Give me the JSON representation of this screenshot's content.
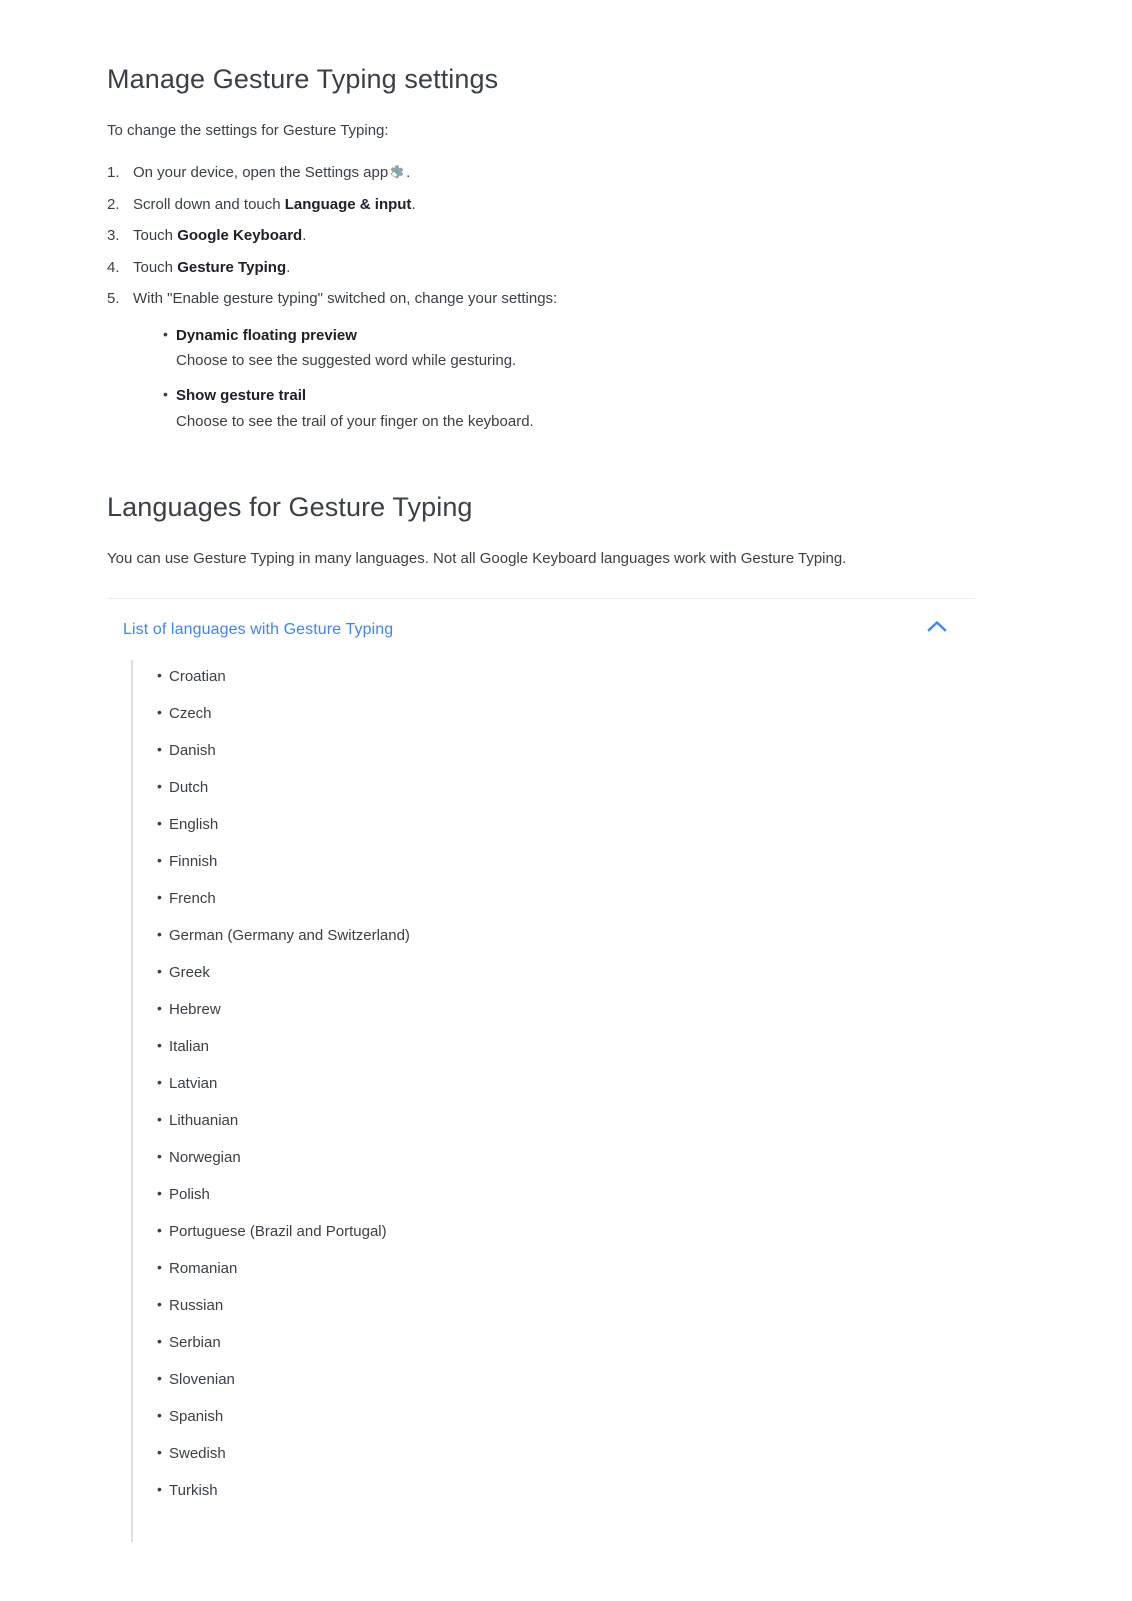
{
  "section1": {
    "heading": "Manage Gesture Typing settings",
    "intro": "To change the settings for Gesture Typing:",
    "steps": [
      {
        "pre": "On your device, open the Settings app",
        "icon": "gear-icon",
        "post": ".",
        "bold": "",
        "tail": ""
      },
      {
        "pre": "Scroll down and touch ",
        "bold": "Language & input",
        "post": "."
      },
      {
        "pre": "Touch ",
        "bold": "Google Keyboard",
        "post": "."
      },
      {
        "pre": "Touch ",
        "bold": "Gesture Typing",
        "post": "."
      },
      {
        "pre": "With \"Enable gesture typing\" switched on, change your settings:",
        "bold": "",
        "post": ""
      }
    ],
    "substeps": [
      {
        "title": "Dynamic floating preview",
        "desc": "Choose to see the suggested word while gesturing."
      },
      {
        "title": "Show gesture trail",
        "desc": "Choose to see the trail of your finger on the keyboard."
      }
    ]
  },
  "section2": {
    "heading": "Languages for Gesture Typing",
    "intro": "You can use Gesture Typing in many languages. Not all Google Keyboard languages work with Gesture Typing.",
    "expander": {
      "title": "List of languages with Gesture Typing",
      "state": "expanded",
      "icon": "chevron-up-icon",
      "languages": [
        "Croatian",
        "Czech",
        "Danish",
        "Dutch",
        "English",
        "Finnish",
        "French",
        "German (Germany and Switzerland)",
        "Greek",
        "Hebrew",
        "Italian",
        "Latvian",
        "Lithuanian",
        "Norwegian",
        "Polish",
        "Portuguese (Brazil and Portugal)",
        "Romanian",
        "Russian",
        "Serbian",
        "Slovenian",
        "Spanish",
        "Swedish",
        "Turkish"
      ]
    }
  },
  "colors": {
    "link": "#4285f4",
    "text": "#3c4043",
    "bold_text": "#202124",
    "divider": "#ececec",
    "panel_border": "#e0e0e0",
    "background": "#ffffff"
  }
}
